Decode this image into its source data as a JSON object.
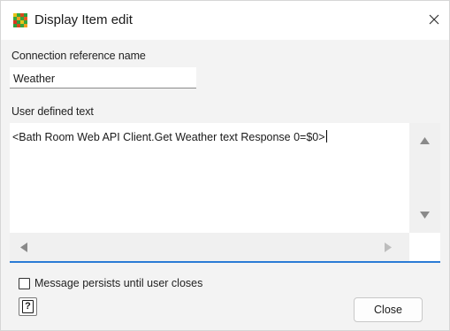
{
  "window": {
    "title": "Display Item edit",
    "icon": "app-grid-icon",
    "close_icon": "close-icon"
  },
  "connection": {
    "label": "Connection reference name",
    "value": "Weather"
  },
  "user_text": {
    "label": "User defined text",
    "value": "<Bath Room Web API Client.Get Weather text Response 0=$0>"
  },
  "scrollbar": {
    "up_icon": "arrow-up-icon",
    "down_icon": "arrow-down-icon",
    "left_icon": "arrow-left-icon",
    "right_icon": "arrow-right-icon"
  },
  "persist": {
    "label": "Message persists until user closes",
    "checked": false
  },
  "footer": {
    "help_icon": "help-icon",
    "help_glyph": "?",
    "close_label": "Close"
  },
  "colors": {
    "focus_accent": "#2b7bd5",
    "window_bg": "#f3f3f3",
    "titlebar_bg": "#ffffff"
  }
}
